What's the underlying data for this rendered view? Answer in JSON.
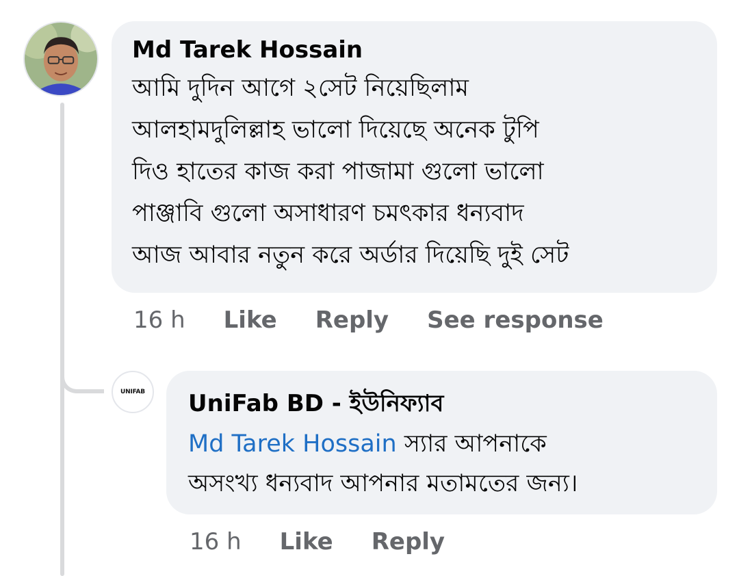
{
  "comment": {
    "author": "Md Tarek Hossain",
    "lines": [
      "আমি দুদিন আগে ২সেট নিয়েছিলাম",
      "আলহামদুলিল্লাহ ভালো দিয়েছে অনেক টুপি",
      "দিও হাতের কাজ করা পাজামা গুলো ভালো",
      "পাঞ্জাবি গুলো অসাধারণ চমৎকার ধন্যবাদ",
      "আজ আবার নতুন করে অর্ডার দিয়েছি দুই সেট"
    ],
    "time": "16 h",
    "like_label": "Like",
    "reply_label": "Reply",
    "see_response_label": "See response"
  },
  "reply": {
    "author": "UniFab BD - ইউনিফ্যাব",
    "avatar_logo_text": "UNIFAB",
    "mention": "Md Tarek Hossain",
    "line1_rest": " স্যার আপনাকে",
    "line2": "অসংখ্য ধন্যবাদ আপনার মতামতের জন্য।",
    "time": "16 h",
    "like_label": "Like",
    "reply_label": "Reply"
  },
  "colors": {
    "bubble": "#f0f2f5",
    "mention": "#1f6fc5",
    "meta_text": "#65676b",
    "thread_line": "#d9dadc"
  }
}
